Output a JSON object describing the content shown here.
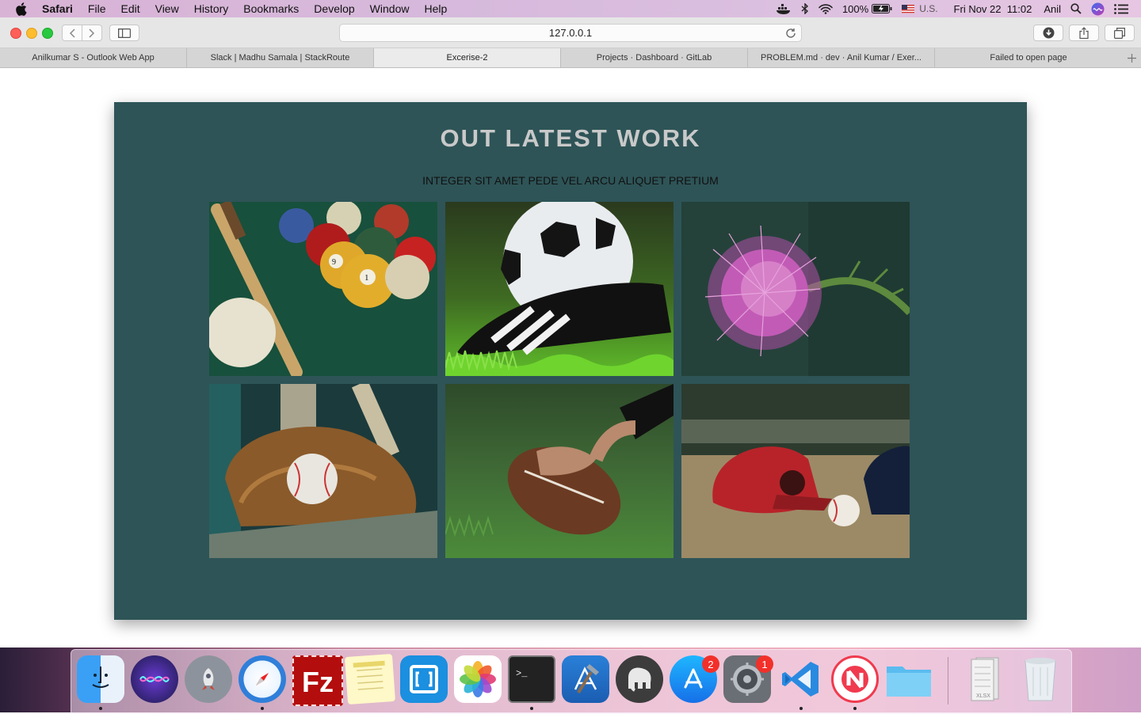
{
  "menubar": {
    "app_name": "Safari",
    "menus": [
      "File",
      "Edit",
      "View",
      "History",
      "Bookmarks",
      "Develop",
      "Window",
      "Help"
    ],
    "battery": "100%",
    "input_source": "U.S.",
    "datetime": "Fri Nov 22  11:02",
    "user": "Anil"
  },
  "toolbar": {
    "url": "127.0.0.1"
  },
  "tabs": [
    {
      "label": "Anilkumar S - Outlook Web App"
    },
    {
      "label": "Slack | Madhu Samala | StackRoute"
    },
    {
      "label": "Excerise-2",
      "active": true
    },
    {
      "label": "Projects · Dashboard · GitLab"
    },
    {
      "label": "PROBLEM.md · dev · Anil Kumar / Exer..."
    },
    {
      "label": "Failed to open page"
    }
  ],
  "page": {
    "title": "OUT LATEST WORK",
    "subtitle": "INTEGER SIT AMET PEDE VEL ARCU ALIQUET PRETIUM",
    "background": "#2e5457"
  },
  "dock": {
    "app_store_badge": "2",
    "settings_badge": "1"
  }
}
